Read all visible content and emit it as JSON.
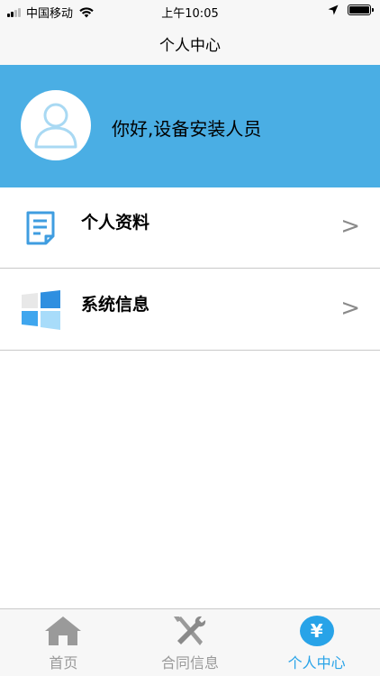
{
  "status_bar": {
    "carrier": "中国移动",
    "time": "上午10:05"
  },
  "nav": {
    "title": "个人中心"
  },
  "profile": {
    "greeting": "你好,设备安装人员"
  },
  "menu": [
    {
      "label": "个人资料",
      "icon": "document-icon",
      "chevron": ">"
    },
    {
      "label": "系统信息",
      "icon": "windows-icon",
      "chevron": ">"
    }
  ],
  "tabs": [
    {
      "label": "首页",
      "icon": "home-icon",
      "active": false
    },
    {
      "label": "合同信息",
      "icon": "tools-icon",
      "active": false
    },
    {
      "label": "个人中心",
      "icon": "yen-icon",
      "glyph": "¥",
      "active": true
    }
  ],
  "colors": {
    "brand_blue": "#4aaee4",
    "active_tab": "#28a3e8",
    "inactive_tab": "#9a9a9a",
    "bar_bg": "#f7f7f7"
  }
}
